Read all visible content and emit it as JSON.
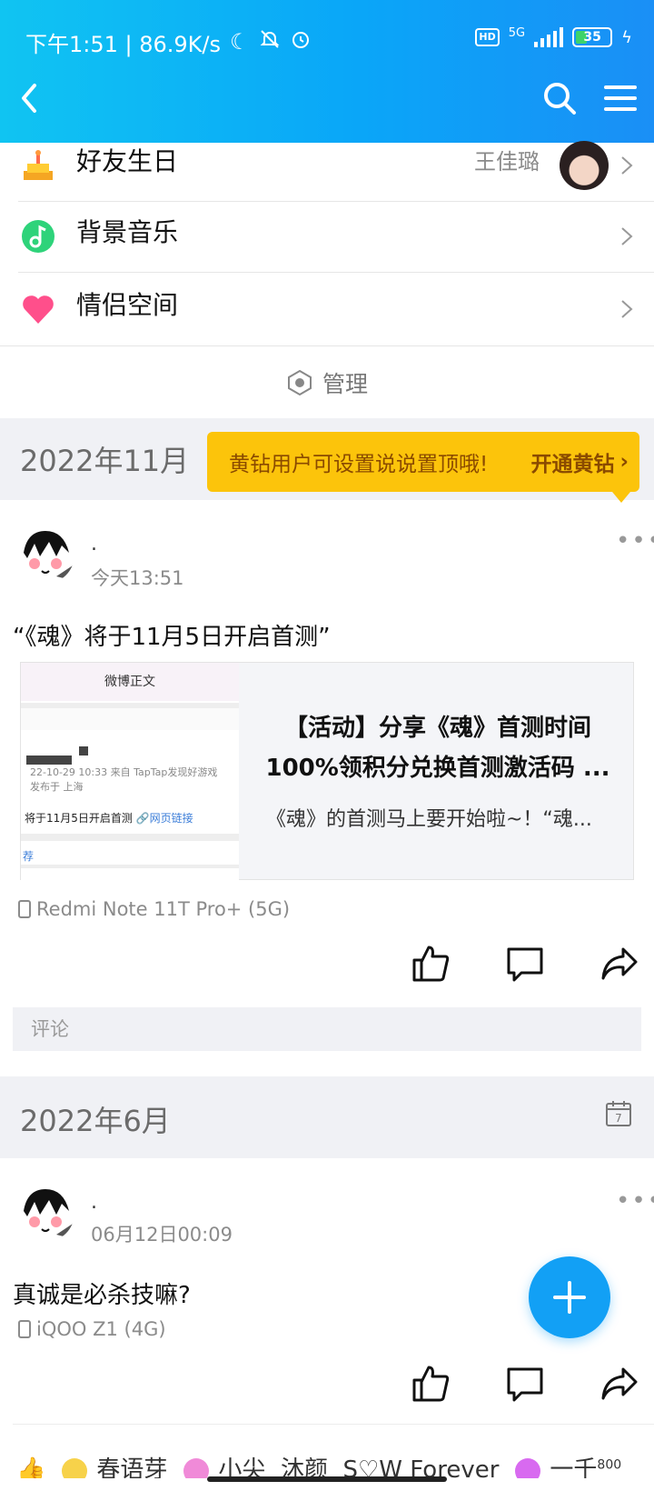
{
  "status_bar": {
    "time_text": "下午1:51 | 86.9K/s",
    "network_type": "5G",
    "hd_label": "HD",
    "battery_level": "35"
  },
  "header": {
    "back_icon": "back-arrow-icon",
    "search_icon": "search-icon",
    "menu_icon": "hamburger-menu-icon",
    "gradient_start": "#10c4f2",
    "gradient_end": "#1a8ff6"
  },
  "settings": [
    {
      "label": "好友生日",
      "extra": "王佳璐",
      "icon": "birthday-cake-icon"
    },
    {
      "label": "背景音乐",
      "icon": "music-note-icon"
    },
    {
      "label": "情侣空间",
      "icon": "heart-icon"
    }
  ],
  "manage_label": "管理",
  "sections": [
    {
      "year": "2022年11月"
    },
    {
      "year": "2022年6月"
    }
  ],
  "promo": {
    "text": "黄钻用户可设置说说置顶哦!",
    "cta": "开通黄钻",
    "color": "#fcc40b"
  },
  "posts": [
    {
      "name": ".",
      "time": "今天13:51",
      "text": "“《魂》将于11月5日开启首测”",
      "card": {
        "thumb_title": "微博正文",
        "thumb_meta": "22-10-29 10:33  来自 TapTap发现好游戏",
        "thumb_location": "发布于 上海",
        "thumb_line": "将于11月5日开启首测",
        "thumb_link": "🔗网页链接",
        "thumb_foot": "荐",
        "title_line1": "【活动】分享《魂》首测时间",
        "title_line2": "100%领积分兑换首测激活码 ...",
        "desc": "《魂》的首测马上要开始啦~！“魂..."
      },
      "device": "Redmi Note 11T Pro+ (5G)",
      "comment_placeholder": "评论"
    },
    {
      "name": ".",
      "time": "06月12日00:09",
      "text": "真诚是必杀技嘛?",
      "device": "iQOO Z1 (4G)"
    }
  ],
  "likes_row": {
    "names": [
      "春语芽",
      "小尖",
      "沐颜",
      "S♡W Forever",
      "一千"
    ],
    "count_badge": "800"
  },
  "fab_color": "#12a0f5"
}
